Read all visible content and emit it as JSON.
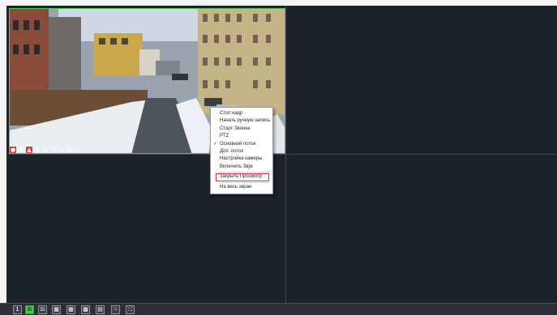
{
  "menu": {
    "items": [
      {
        "label": "Стоп кадр"
      },
      {
        "label": "Начать ручную запись"
      },
      {
        "label": "Старт Звонка"
      },
      {
        "label": "PTZ"
      },
      {
        "label": "Основной поток",
        "checked": true
      },
      {
        "label": "Доп. поток"
      },
      {
        "label": "Настройка камеры"
      },
      {
        "label": "Включить Звук"
      },
      {
        "label": "Закрыть Просмотр",
        "highlighted": true
      },
      {
        "label": "На весь экран"
      }
    ]
  },
  "camera_toolbar": {
    "icons": [
      "record-icon",
      "snapshot-icon",
      "alarm-icon",
      "settings-icon",
      "microphone-icon",
      "speak-icon",
      "audio-icon",
      "zoom-icon",
      "fullscreen-icon"
    ]
  },
  "bottom_bar": {
    "buttons": [
      {
        "label": "1",
        "icon": "layout-1-icon"
      },
      {
        "label": "4",
        "icon": "layout-4-icon",
        "active": true
      },
      {
        "label": "6",
        "icon": "layout-6-icon"
      },
      {
        "label": "8",
        "icon": "layout-8-icon"
      },
      {
        "label": "9",
        "icon": "layout-9-icon"
      },
      {
        "label": "16",
        "icon": "layout-16-icon"
      },
      {
        "label": "",
        "icon": "custom-layout-icon"
      },
      {
        "label": "",
        "icon": "close-all-icon"
      },
      {
        "label": "",
        "icon": "fullscreen-grid-icon"
      }
    ]
  },
  "colors": {
    "accent": "#3fd14a",
    "highlight_border": "#d93636",
    "grid_background": "#1c222a"
  }
}
